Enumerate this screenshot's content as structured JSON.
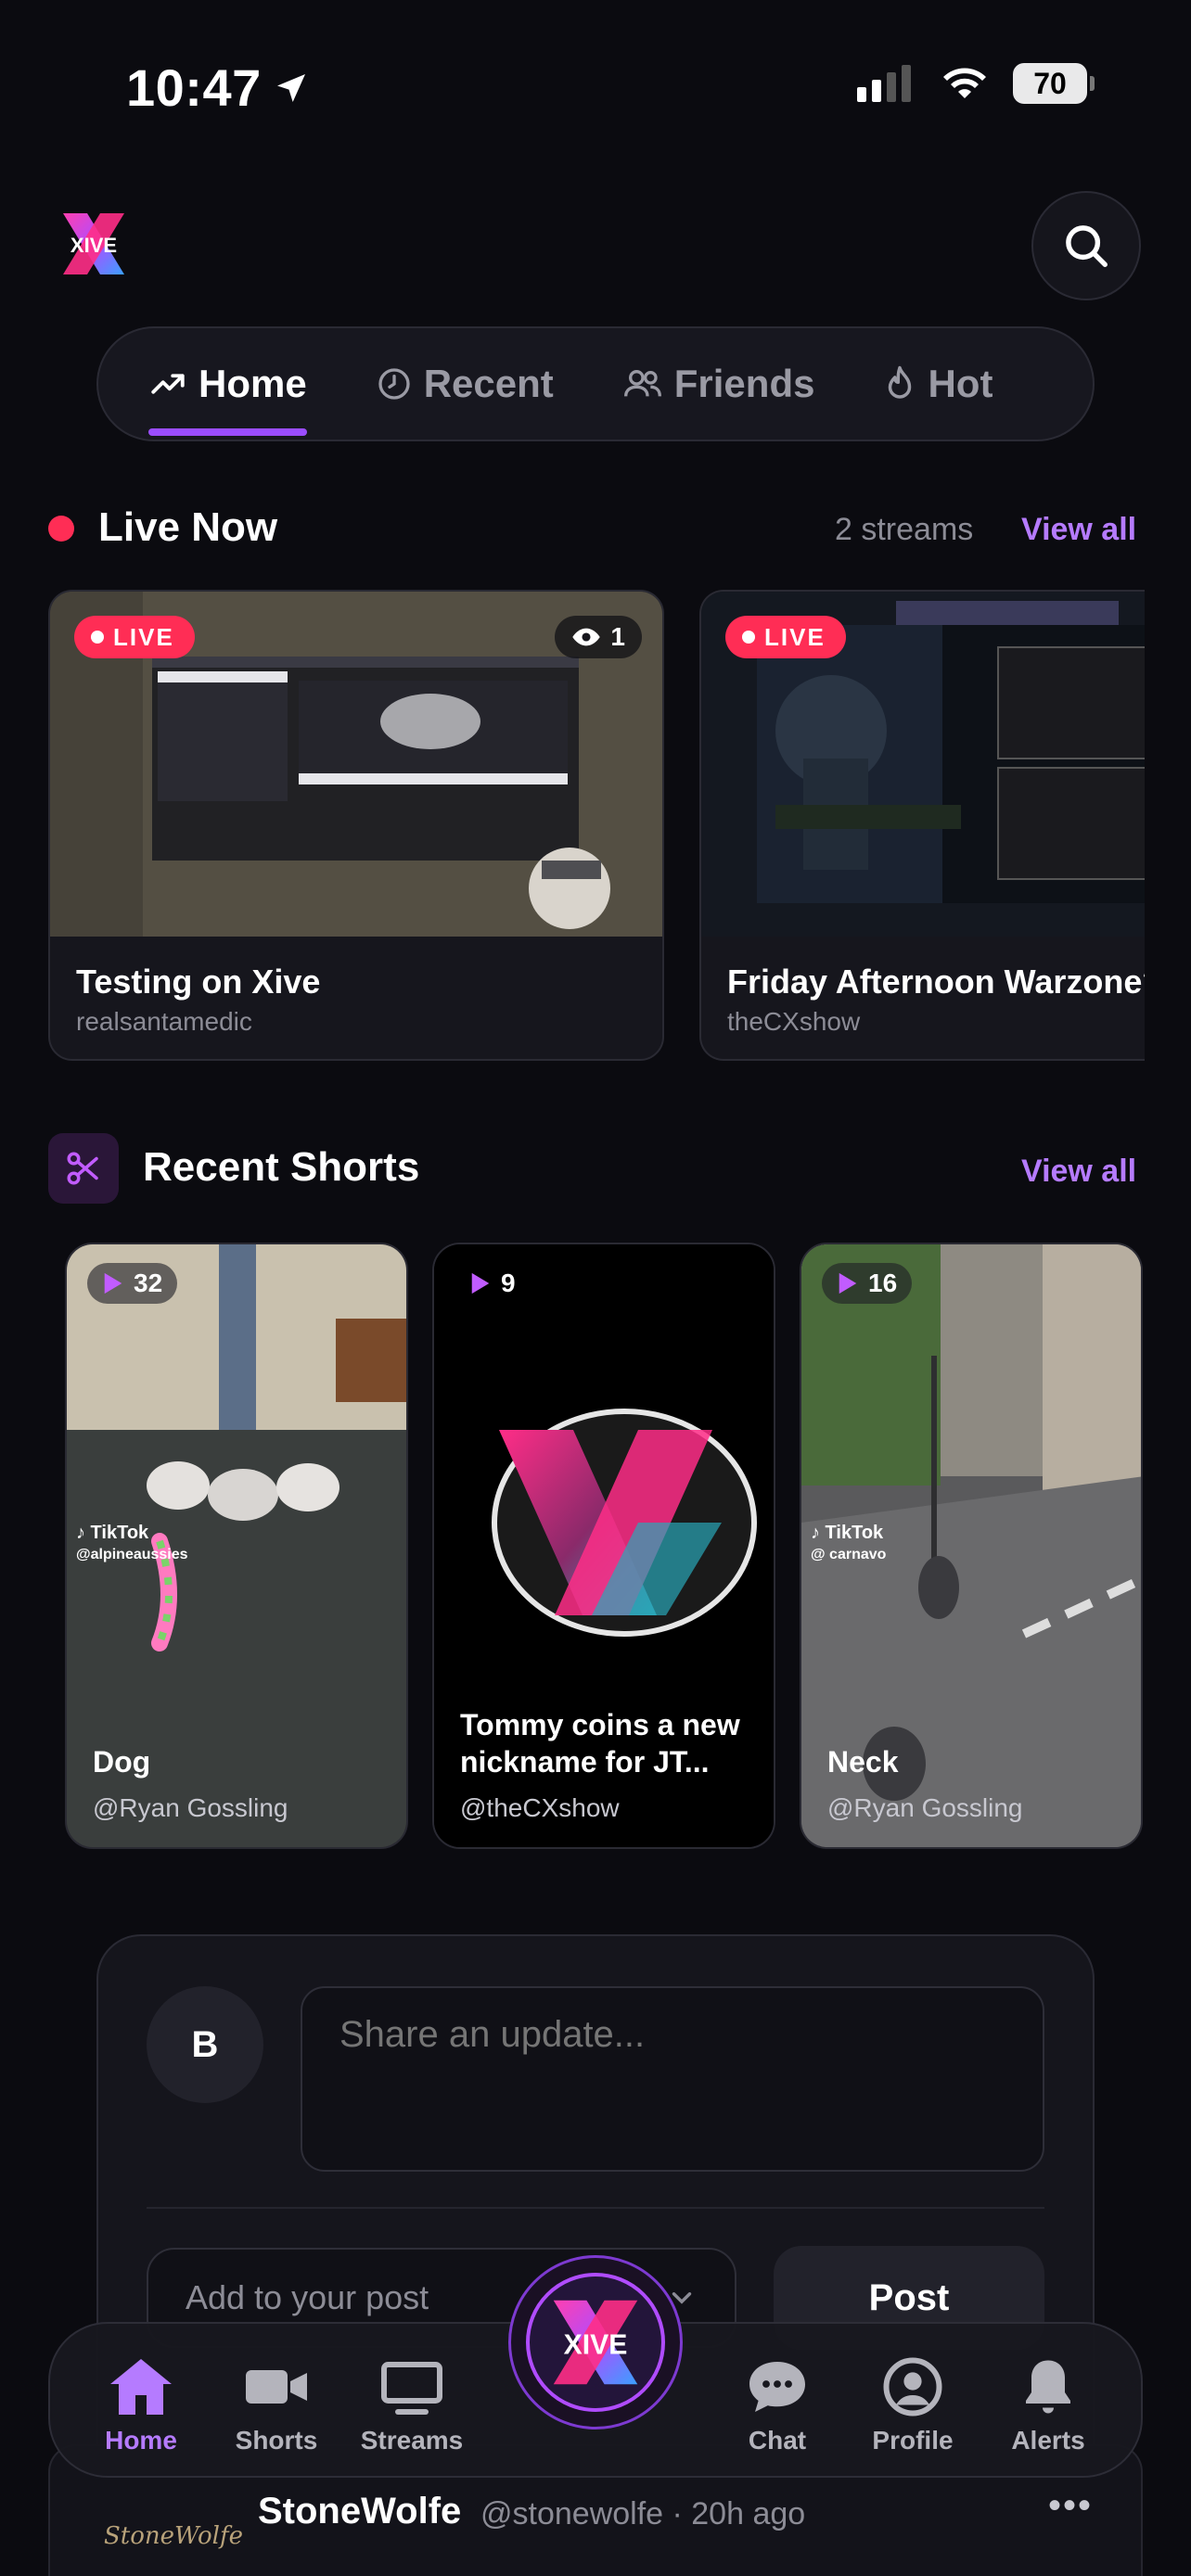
{
  "status_bar": {
    "time": "10:47",
    "battery": "70"
  },
  "header": {
    "logo_text": "XIVE"
  },
  "tabs": [
    {
      "label": "Home",
      "icon": "trending-icon",
      "active": true
    },
    {
      "label": "Recent",
      "icon": "clock-icon",
      "active": false
    },
    {
      "label": "Friends",
      "icon": "friends-icon",
      "active": false
    },
    {
      "label": "Hot",
      "icon": "flame-icon",
      "active": false
    }
  ],
  "live_now": {
    "title": "Live Now",
    "count": "2 streams",
    "view_all": "View all",
    "streams": [
      {
        "badge": "LIVE",
        "viewers": "1",
        "title": "Testing on Xive",
        "user": "realsantamedic"
      },
      {
        "badge": "LIVE",
        "title": "Friday Afternoon Warzone?",
        "user": "theCXshow"
      }
    ]
  },
  "recent_shorts": {
    "title": "Recent Shorts",
    "view_all": "View all",
    "shorts": [
      {
        "count": "32",
        "title": "Dog",
        "user": "@Ryan Gossling",
        "watermark": "TikTok\n@alpineaussies"
      },
      {
        "count": "9",
        "title": "Tommy coins a new nickname for JT...",
        "user": "@theCXshow"
      },
      {
        "count": "16",
        "title": "Neck",
        "user": "@Ryan Gossling",
        "watermark": "TikTok\n@ carnavo"
      }
    ]
  },
  "composer": {
    "avatar_letter": "B",
    "placeholder": "Share an update...",
    "add_to_post": "Add to your post",
    "post_button": "Post"
  },
  "feed": {
    "name": "StoneWolfe",
    "meta": "@stonewolfe · 20h ago",
    "more": "•••",
    "logo_text": "StoneWolfe"
  },
  "bottom_nav": [
    {
      "label": "Home",
      "active": true
    },
    {
      "label": "Shorts"
    },
    {
      "label": "Streams"
    },
    {
      "label": "Chat"
    },
    {
      "label": "Profile"
    },
    {
      "label": "Alerts"
    }
  ],
  "colors": {
    "accent": "#b57bff",
    "live": "#ff2d55",
    "background": "#0b0b10"
  }
}
